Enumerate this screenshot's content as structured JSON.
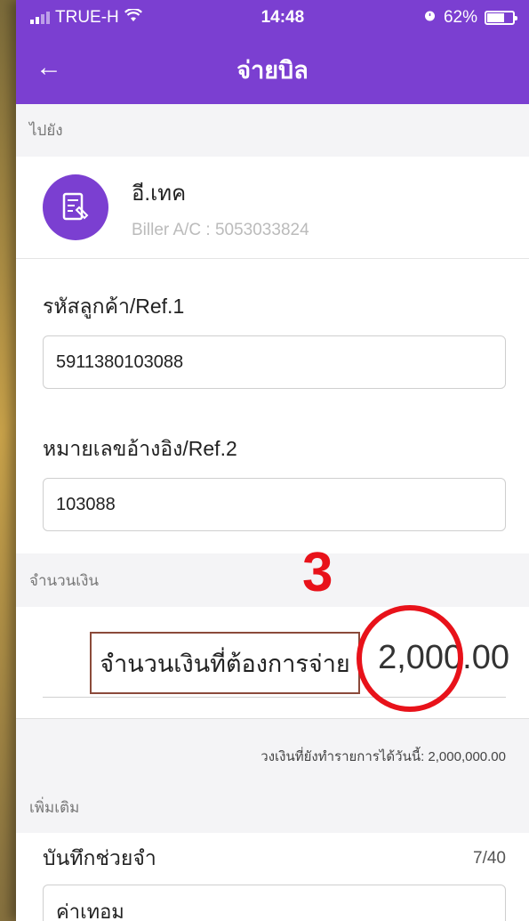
{
  "status_bar": {
    "carrier": "TRUE-H",
    "time": "14:48",
    "battery": "62%"
  },
  "header": {
    "title": "จ่ายบิล"
  },
  "to_section": {
    "label": "ไปยัง"
  },
  "biller": {
    "name": "อี.เทค",
    "account": "Biller A/C : 5053033824"
  },
  "ref1": {
    "label": "รหัสลูกค้า/Ref.1",
    "value": "5911380103088"
  },
  "ref2": {
    "label": "หมายเลขอ้างอิง/Ref.2",
    "value": "103088"
  },
  "amount_section": {
    "label": "จำนวนเงิน"
  },
  "amount": {
    "placeholder": "จำนวนเงินที่ต้องการจ่าย",
    "value": "2,000.00"
  },
  "annotation": {
    "step": "3",
    "color": "#e8121a"
  },
  "limit": {
    "text": "วงเงินที่ยังทำรายการได้วันนี้: 2,000,000.00"
  },
  "more_section": {
    "label": "เพิ่มเติม"
  },
  "note": {
    "label": "บันทึกช่วยจำ",
    "count": "7/40",
    "value": "ค่าเทอม"
  },
  "colors": {
    "brand": "#7b3fd1",
    "annotation": "#e8121a"
  }
}
